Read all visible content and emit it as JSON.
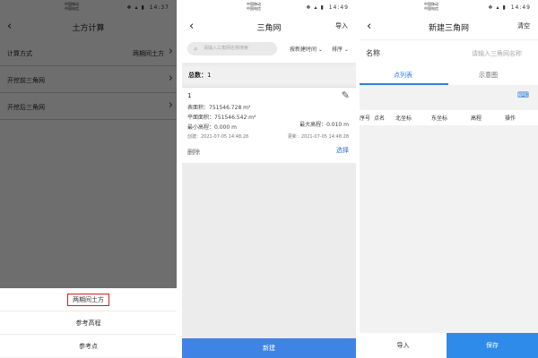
{
  "status": {
    "carrier1": "中国移动",
    "carrier2": "中国电信",
    "icons": "❖ ▴ ▮",
    "time1": "14:37",
    "time2": "14:49",
    "time3": "14:49"
  },
  "panel1": {
    "title": "土方计算",
    "rows": [
      {
        "label": "计算方式",
        "value": "两期间土方"
      },
      {
        "label": "开挖前三角网",
        "value": ""
      },
      {
        "label": "开挖后三角网",
        "value": ""
      }
    ],
    "sheet": [
      "两期间土方",
      "参考高程",
      "参考点"
    ],
    "highlight_color": "#d61d1d"
  },
  "panel2": {
    "title": "三角网",
    "import": "导入",
    "search_placeholder": "请输入三角网名称搜索",
    "sort1": "按新建时间",
    "sort2": "排序",
    "total_label": "总数：",
    "total_value": "1",
    "card": {
      "index": "1",
      "surface_area": "表面积：751546.728 m²",
      "plane_area": "平面面积：751546.542 m²",
      "min_elev": "最小高程：0.000 m",
      "max_elev": "最大高程：0.010 m",
      "created": "创建：2021-07-05 14:48:28",
      "updated": "更新：2021-07-05 14:48:28",
      "delete": "删除",
      "select": "选择"
    },
    "new_button": "新建",
    "accent": "#3f84e5"
  },
  "panel3": {
    "title": "新建三角网",
    "clear": "清空",
    "name_label": "名称",
    "name_placeholder": "请输入三角网名称",
    "tab1": "点列表",
    "tab2": "示意图",
    "columns": [
      "序号",
      "点名",
      "北坐标",
      "东坐标",
      "高程",
      "操作"
    ],
    "import": "导入",
    "save": "保存",
    "accent": "#2f7fe0"
  }
}
